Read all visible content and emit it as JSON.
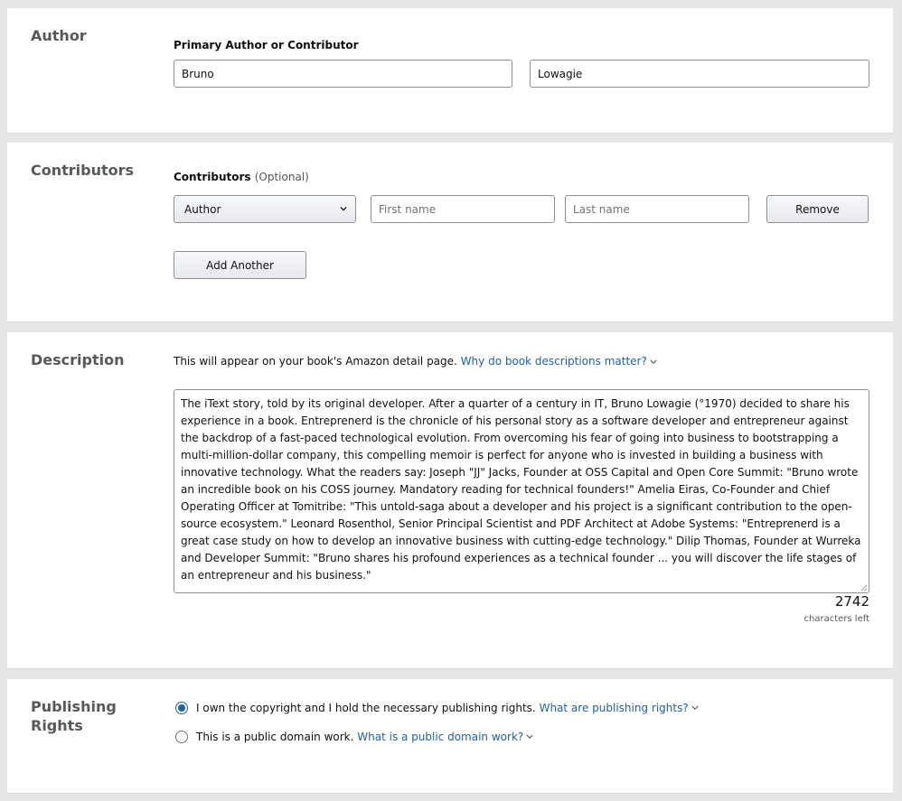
{
  "author": {
    "section_title": "Author",
    "field_label": "Primary Author or Contributor",
    "first_name_value": "Bruno",
    "last_name_value": "Lowagie"
  },
  "contributors": {
    "section_title": "Contributors",
    "field_label": "Contributors",
    "optional_label": "(Optional)",
    "role_selected": "Author",
    "first_name_placeholder": "First name",
    "last_name_placeholder": "Last name",
    "remove_label": "Remove",
    "add_another_label": "Add Another"
  },
  "description": {
    "section_title": "Description",
    "intro_text": "This will appear on your book's Amazon detail page.",
    "help_link": "Why do book descriptions matter?",
    "text": "The iText story, told by its original developer. After a quarter of a century in IT, Bruno Lowagie (°1970) decided to share his experience in a book. Entreprenerd is the chronicle of his personal story as a software developer and entrepreneur against the backdrop of a fast-paced technological evolution. From overcoming his fear of going into business to bootstrapping a multi-million-dollar company, this compelling memoir is perfect for anyone who is invested in building a business with innovative technology. What the readers say: Joseph \"JJ\" Jacks, Founder at OSS Capital and Open Core Summit: \"Bruno wrote an incredible book on his COSS journey. Mandatory reading for technical founders!\" Amelia Eiras, Co-Founder and Chief Operating Officer at Tomitribe: \"This untold-saga about a developer and his project is a significant contribution to the open-source ecosystem.\" Leonard Rosenthol, Senior Principal Scientist and PDF Architect at Adobe Systems: \"Entreprenerd is a great case study on how to develop an innovative business with cutting-edge technology.\" Dilip Thomas, Founder at Wurreka and Developer Summit: \"Bruno shares his profound experiences as a technical founder ... you will discover the life stages of an entrepreneur and his business.\"",
    "characters_left_count": "2742",
    "characters_left_label": "characters left"
  },
  "publishing_rights": {
    "section_title_line1": "Publishing",
    "section_title_line2": "Rights",
    "option_own_copyright": "I own the copyright and I hold the necessary publishing rights.",
    "option_own_copyright_link": "What are publishing rights?",
    "option_own_copyright_selected": true,
    "option_public_domain": "This is a public domain work.",
    "option_public_domain_link": "What is a public domain work?",
    "option_public_domain_selected": false
  },
  "colors": {
    "link": "#2162a1",
    "page_background": "#e7e7e7",
    "section_background": "#ffffff",
    "section_title": "#565959"
  }
}
